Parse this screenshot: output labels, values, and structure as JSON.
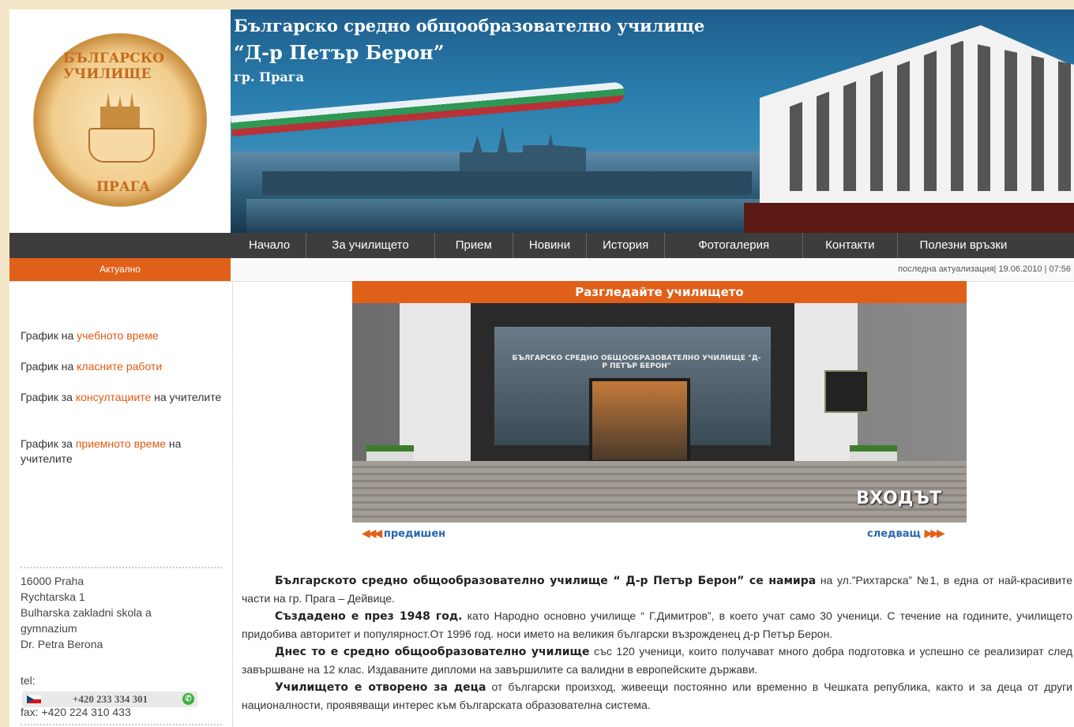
{
  "header": {
    "title_line1": "Българско средно общообразователно училище",
    "title_line2": "“Д-р Петър Берон”",
    "title_line3": "гр. Прага",
    "logo_top": "БЪЛГАРСКО УЧИЛИЩЕ",
    "logo_bottom": "ПРАГА"
  },
  "nav": [
    "Начало",
    "За училището",
    "Прием",
    "Новини",
    "История",
    "Фотогалерия",
    "Контакти",
    "Полезни връзки"
  ],
  "subbar": {
    "section": "Актуално",
    "last_update": "последна актуализация| 19.06.2010 | 07:56"
  },
  "sidebar": {
    "links": [
      {
        "pre": "График на ",
        "hl": "учебното време",
        "post": ""
      },
      {
        "pre": "График на ",
        "hl": "класните работи",
        "post": ""
      },
      {
        "pre": "График за ",
        "hl": "консултациите",
        "post": " на учителите"
      },
      {
        "pre": "График за ",
        "hl": "приемното време",
        "post": " на учителите"
      }
    ],
    "address": [
      "16000 Praha",
      "Rychtarska 1",
      "Bulharska zakladni skola a",
      "gymnazium",
      "Dr. Petra Berona"
    ],
    "tel_label": "tel:",
    "phone": "+420 233 334 301",
    "fax": "fax: +420 224 310 433"
  },
  "gallery": {
    "heading": "Разгледайте училището",
    "sign_text": "БЪЛГАРСКО СРЕДНО ОБЩООБРАЗОВАТЕЛНО УЧИЛИЩЕ \"Д-Р ПЕТЪР БЕРОН\"",
    "photo_label": "ВХОДЪТ",
    "prev": "предишен",
    "next": "следващ"
  },
  "article": [
    {
      "bold": "Българското средно общообразователно училище “ Д-р Петър Берон” се намира",
      "text": " на ул.”Рихтарска” №1, в една от най-красивите части на гр. Прага – Дейвице."
    },
    {
      "bold": "Създадено е през 1948 год.",
      "text": " като Народно основно училище “ Г.Димитров”, в което учат само 30 ученици. С течение на годините, училището придобива авторитет и популярност.От 1996 год. носи името на великия български възрожденец д-р Петър Берон."
    },
    {
      "bold": "Днес то е средно общообразователно училище",
      "text": " със 120 ученици, които получават много добра подготовка и успешно се реализират след завършване на 12 клас. Издаваните дипломи на завършилите са валидни в европейските държави."
    },
    {
      "bold": "Училището е отворено за деца",
      "text": " от български произход, живеещи постоянно или временно в Чешката република, както и за деца от други националности, проявяващи интерес към българската образователна система."
    }
  ],
  "colors": {
    "accent": "#e06019",
    "nav_bg": "#3d3d3d",
    "link_blue": "#2766b0"
  }
}
